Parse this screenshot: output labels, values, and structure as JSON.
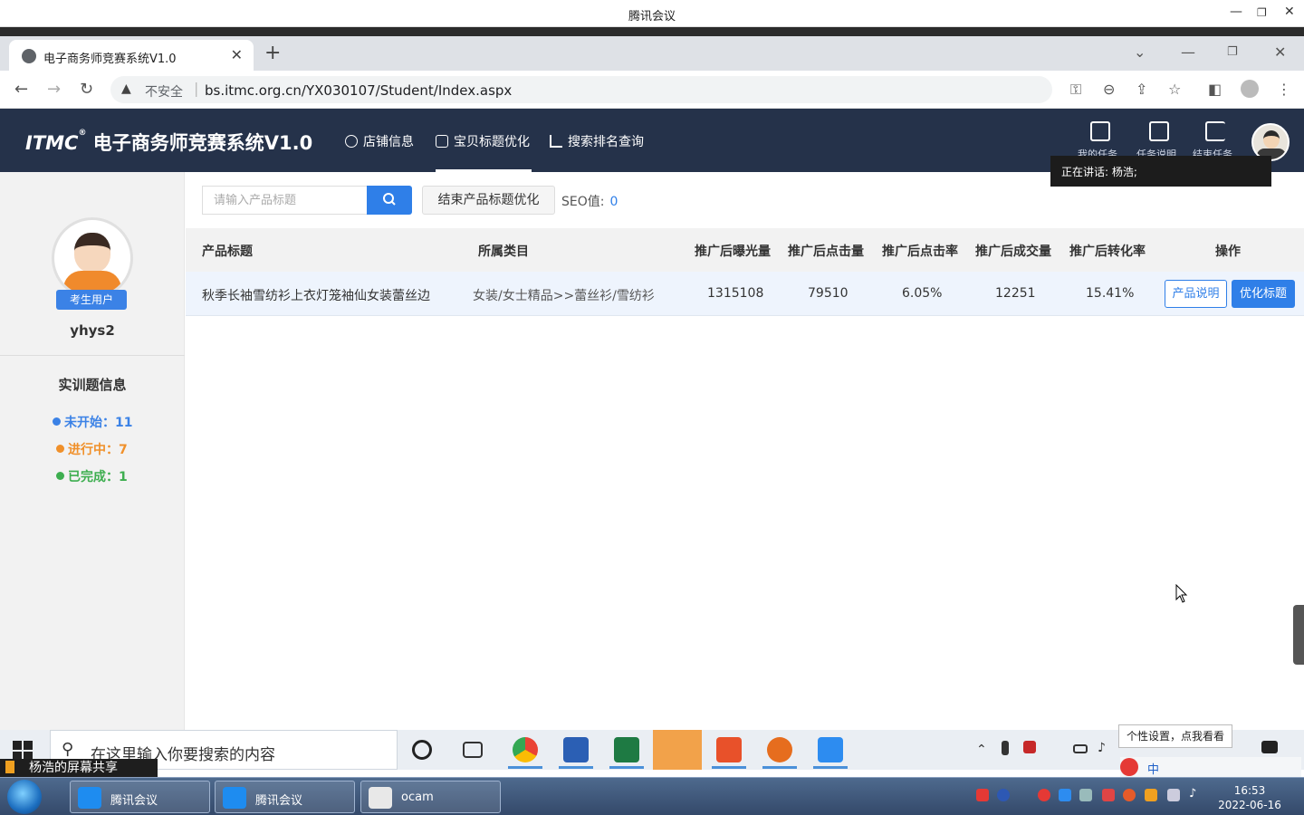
{
  "meeting": {
    "title": "腾讯会议"
  },
  "browser": {
    "tab_title": "电子商务师竞赛系统V1.0",
    "insecure_label": "不安全",
    "url": "bs.itmc.org.cn/YX030107/Student/Index.aspx"
  },
  "app": {
    "logo_brand": "ITMC",
    "logo_reg": "®",
    "logo_name": "电子商务师竞赛系统V1.0",
    "nav": [
      {
        "label": "店铺信息"
      },
      {
        "label": "宝贝标题优化"
      },
      {
        "label": "搜索排名查询"
      }
    ],
    "header_icons": [
      {
        "label": "我的任务"
      },
      {
        "label": "任务说明"
      },
      {
        "label": "结束任务"
      }
    ],
    "speaking": "正在讲话: 杨浩;"
  },
  "sidebar": {
    "role": "考生用户",
    "username": "yhys2",
    "section_title": "实训题信息",
    "stats": [
      {
        "text": "未开始：11",
        "color": "#3b82e6"
      },
      {
        "text": "进行中：7",
        "color": "#f0902a"
      },
      {
        "text": "已完成：1",
        "color": "#3dae4f"
      }
    ]
  },
  "toolbar": {
    "search_placeholder": "请输入产品标题",
    "end_button": "结束产品标题优化",
    "seo_label": "SEO值:",
    "seo_value": "0"
  },
  "table": {
    "headers": [
      "产品标题",
      "所属类目",
      "推广后曝光量",
      "推广后点击量",
      "推广后点击率",
      "推广后成交量",
      "推广后转化率",
      "操作"
    ],
    "rows": [
      {
        "title": "秋季长袖雪纺衫上衣灯笼袖仙女装蕾丝边",
        "category": "女装/女士精品>>蕾丝衫/雪纺衫",
        "exposure": "1315108",
        "clicks": "79510",
        "ctr": "6.05%",
        "deals": "12251",
        "conversion": "15.41%",
        "btn_explain": "产品说明",
        "btn_optimize": "优化标题"
      }
    ]
  },
  "taskbar": {
    "search_placeholder": "在这里输入你要搜索的内容",
    "tooltip": "个性设置，点我看看",
    "share_label": "杨浩的屏幕共享",
    "tasks": [
      {
        "label": "腾讯会议"
      },
      {
        "label": "腾讯会议"
      },
      {
        "label": "ocam"
      }
    ],
    "time": "16:53",
    "date": "2022-06-16"
  }
}
